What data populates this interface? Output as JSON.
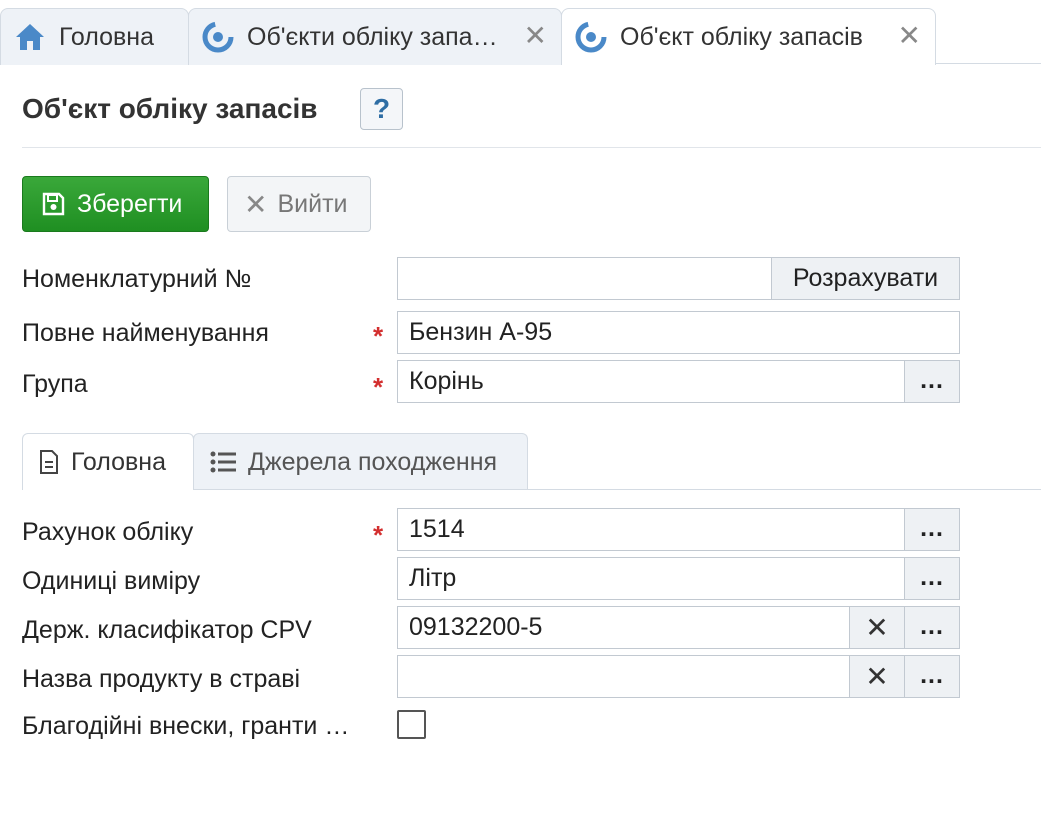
{
  "tabs": [
    {
      "label": "Головна"
    },
    {
      "label": "Об'єкти обліку запа…"
    },
    {
      "label": "Об'єкт обліку запасів"
    }
  ],
  "page": {
    "title": "Об'єкт обліку запасів",
    "help": "?"
  },
  "toolbar": {
    "save_label": "Зберегти",
    "exit_label": "Вийти"
  },
  "form": {
    "nomenclature": {
      "label": "Номенклатурний №",
      "value": "",
      "button": "Розрахувати"
    },
    "full_name": {
      "label": "Повне найменування",
      "value": "Бензин А-95"
    },
    "group": {
      "label": "Група",
      "value": "Корінь"
    },
    "required_mark": "*",
    "lookup_label": "...",
    "clear_label": "✕"
  },
  "inner_tabs": [
    {
      "label": "Головна"
    },
    {
      "label": "Джерела походження"
    }
  ],
  "main_tab": {
    "account": {
      "label": "Рахунок обліку",
      "value": "1514"
    },
    "units": {
      "label": "Одиниці виміру",
      "value": "Літр"
    },
    "cpv": {
      "label": "Держ. класифікатор CPV",
      "value": "09132200-5"
    },
    "dish_product": {
      "label": "Назва продукту в страві",
      "value": ""
    },
    "charity": {
      "label": "Благодійні внески, гранти …",
      "checked": false
    }
  }
}
